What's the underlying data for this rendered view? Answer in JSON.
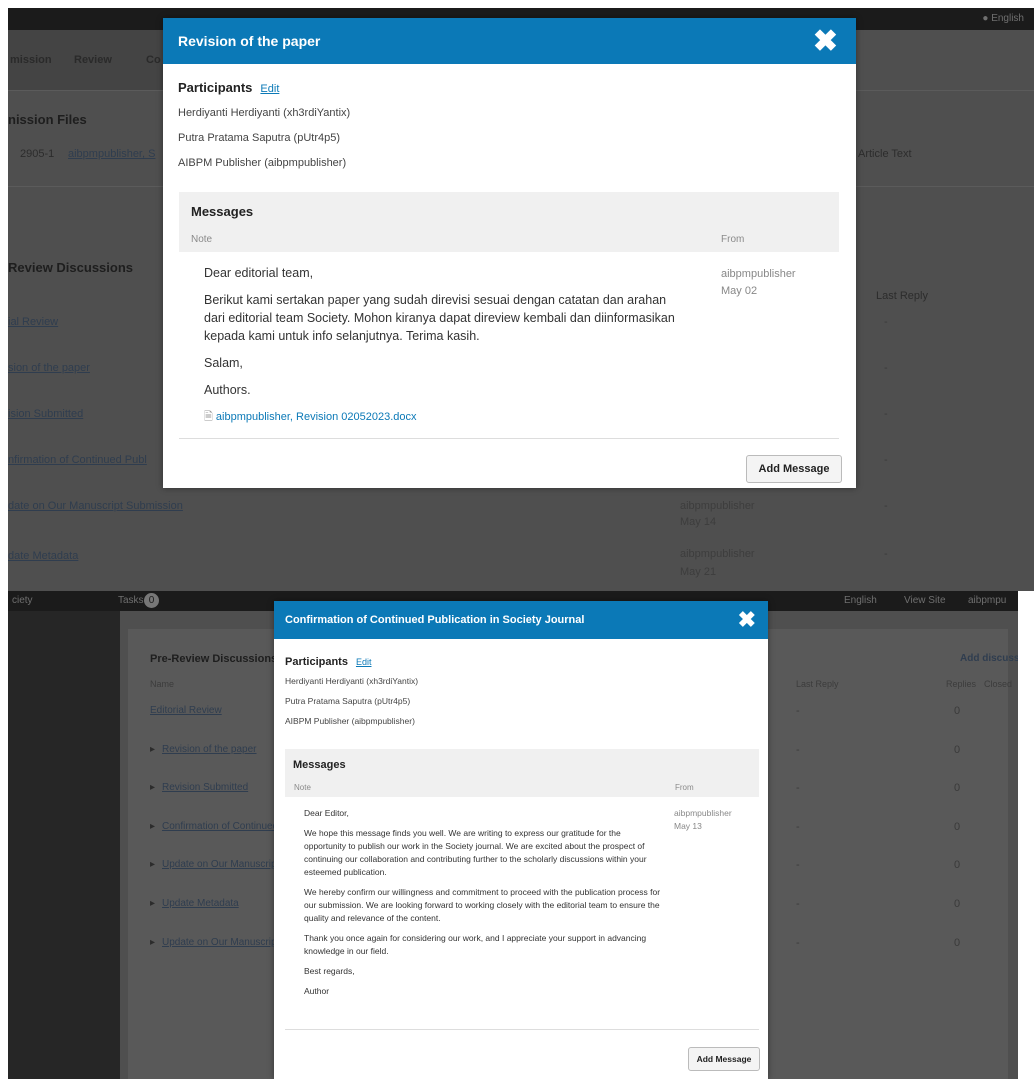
{
  "shot1": {
    "topbar": {
      "lang": "English"
    },
    "tabs": [
      "mission",
      "Review",
      "Co"
    ],
    "files_title": "nission Files",
    "file_row": {
      "id": "2905-1",
      "name": "aibpmpublisher, S",
      "type": "Article Text"
    },
    "discussions_title": "Review Discussions",
    "last_reply_header": "Last Reply",
    "rows": [
      {
        "title": "ial Review",
        "from": "",
        "date": "",
        "reply": "-"
      },
      {
        "title": "sion of the paper",
        "from": "",
        "date": "",
        "reply": "-"
      },
      {
        "title": "ision Submitted",
        "from": "",
        "date": "",
        "reply": "-"
      },
      {
        "title": "nfirmation of Continued Publ",
        "from": "",
        "date": "",
        "reply": "-"
      },
      {
        "title": "date on Our Manuscript Submission",
        "from": "aibpmpublisher",
        "date": "May 14",
        "reply": "-"
      },
      {
        "title": "date Metadata",
        "from": "aibpmpublisher",
        "date": "May 21",
        "reply": "-"
      }
    ],
    "modal": {
      "title": "Revision of the paper",
      "participants_label": "Participants",
      "edit_label": "Edit",
      "participants": [
        "Herdiyanti Herdiyanti (xh3rdiYantix)",
        "Putra Pratama Saputra (pUtr4p5)",
        "AIBPM Publisher (aibpmpublisher)"
      ],
      "messages_title": "Messages",
      "col_note": "Note",
      "col_from": "From",
      "message": {
        "paragraphs": [
          "Dear editorial team,",
          "Berikut kami sertakan paper yang sudah direvisi sesuai dengan catatan dan arahan dari editorial team Society. Mohon kiranya dapat direview kembali dan diinformasikan kepada kami untuk info selanjutnya. Terima kasih.",
          "Salam,",
          "Authors."
        ],
        "attachment": "aibpmpublisher, Revision 02052023.docx",
        "from": "aibpmpublisher",
        "date": "May 02"
      },
      "add_button": "Add Message"
    }
  },
  "shot2": {
    "topbar": {
      "brand": "ciety",
      "tasks": "Tasks",
      "tasks_count": "0",
      "lang": "English",
      "view_site": "View Site",
      "user": "aibpmpu"
    },
    "panel": {
      "title": "Pre-Review Discussions",
      "add_link": "Add discussion",
      "col_name": "Name",
      "col_last_reply": "Last Reply",
      "col_replies": "Replies",
      "col_closed": "Closed",
      "rows": [
        {
          "title": "Editorial Review",
          "reply": "-",
          "count": "0"
        },
        {
          "title": "Revision of the paper",
          "reply": "-",
          "count": "0"
        },
        {
          "title": "Revision Submitted",
          "reply": "-",
          "count": "0"
        },
        {
          "title": "Confirmation of Continued Publ",
          "reply": "-",
          "count": "0"
        },
        {
          "title": "Update on Our Manuscript Sub",
          "reply": "-",
          "count": "0"
        },
        {
          "title": "Update Metadata",
          "reply": "-",
          "count": "0"
        },
        {
          "title": "Update on Our Manuscript Sub",
          "reply": "-",
          "count": "0"
        }
      ]
    },
    "modal": {
      "title": "Confirmation of Continued Publication in Society Journal",
      "participants_label": "Participants",
      "edit_label": "Edit",
      "participants": [
        "Herdiyanti Herdiyanti (xh3rdiYantix)",
        "Putra Pratama Saputra (pUtr4p5)",
        "AIBPM Publisher (aibpmpublisher)"
      ],
      "messages_title": "Messages",
      "col_note": "Note",
      "col_from": "From",
      "message": {
        "paragraphs": [
          "Dear Editor,",
          "We hope this message finds you well. We are writing to express our gratitude for the opportunity to publish our work in the Society journal. We are excited about the prospect of continuing our collaboration and contributing further to the scholarly discussions within your esteemed publication.",
          "We hereby confirm our willingness and commitment to proceed with the publication process for our submission. We are looking forward to working closely with the editorial team to ensure the quality and relevance of the content.",
          "Thank you once again for considering our work, and I appreciate your support in advancing knowledge in our field.",
          "Best regards,",
          "Author"
        ],
        "from": "aibpmpublisher",
        "date": "May 13"
      },
      "add_button": "Add Message"
    }
  }
}
